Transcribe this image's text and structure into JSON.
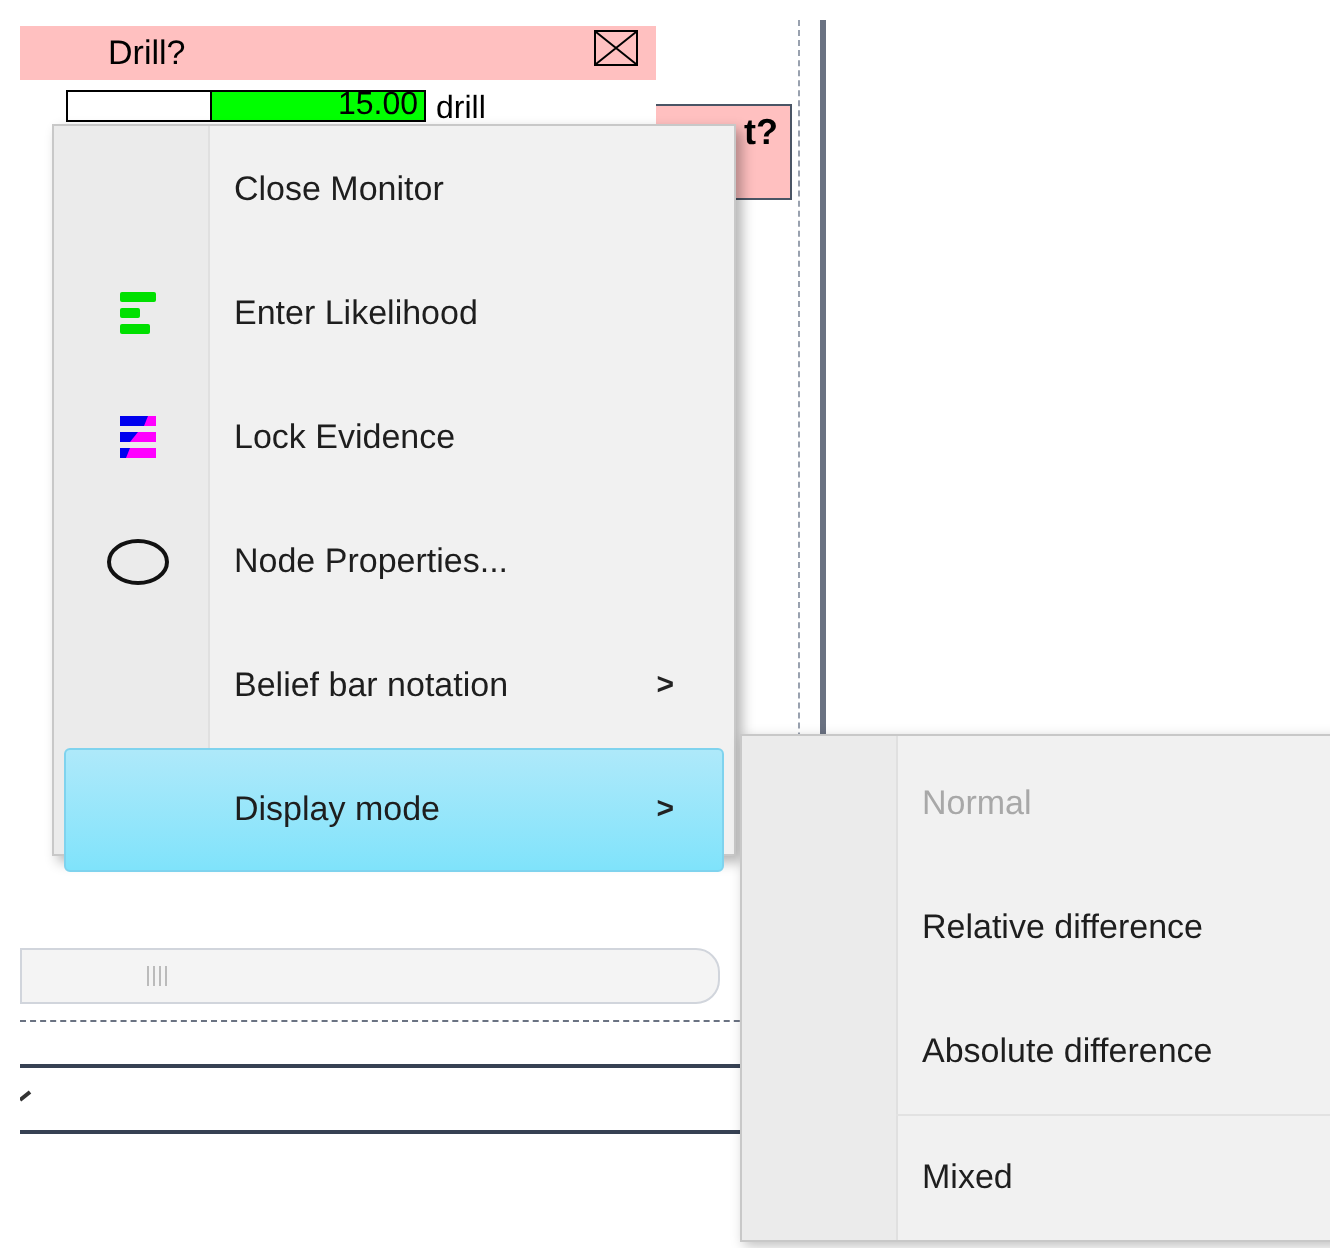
{
  "monitor": {
    "title": "Drill?",
    "value": "15.00",
    "state_label": "drill",
    "level": 0.6
  },
  "background_node": {
    "title_fragment": "t?"
  },
  "context_menu": {
    "items": [
      {
        "label": "Close Monitor",
        "kind": "command",
        "selected": false
      },
      {
        "label": "Enter Likelihood",
        "kind": "command",
        "selected": false
      },
      {
        "label": "Lock Evidence",
        "kind": "command",
        "selected": false
      },
      {
        "label": "Node Properties...",
        "kind": "command",
        "selected": false
      },
      {
        "label": "Belief bar notation",
        "kind": "submenu",
        "arrow": ">",
        "selected": false
      },
      {
        "label": "Display mode",
        "kind": "submenu",
        "arrow": ">",
        "selected": true
      }
    ]
  },
  "submenu": {
    "items": [
      {
        "label": "Normal",
        "disabled": true
      },
      {
        "label": "Relative difference",
        "disabled": false
      },
      {
        "label": "Absolute difference",
        "disabled": false
      },
      {
        "label": "Mixed",
        "disabled": false
      }
    ]
  }
}
